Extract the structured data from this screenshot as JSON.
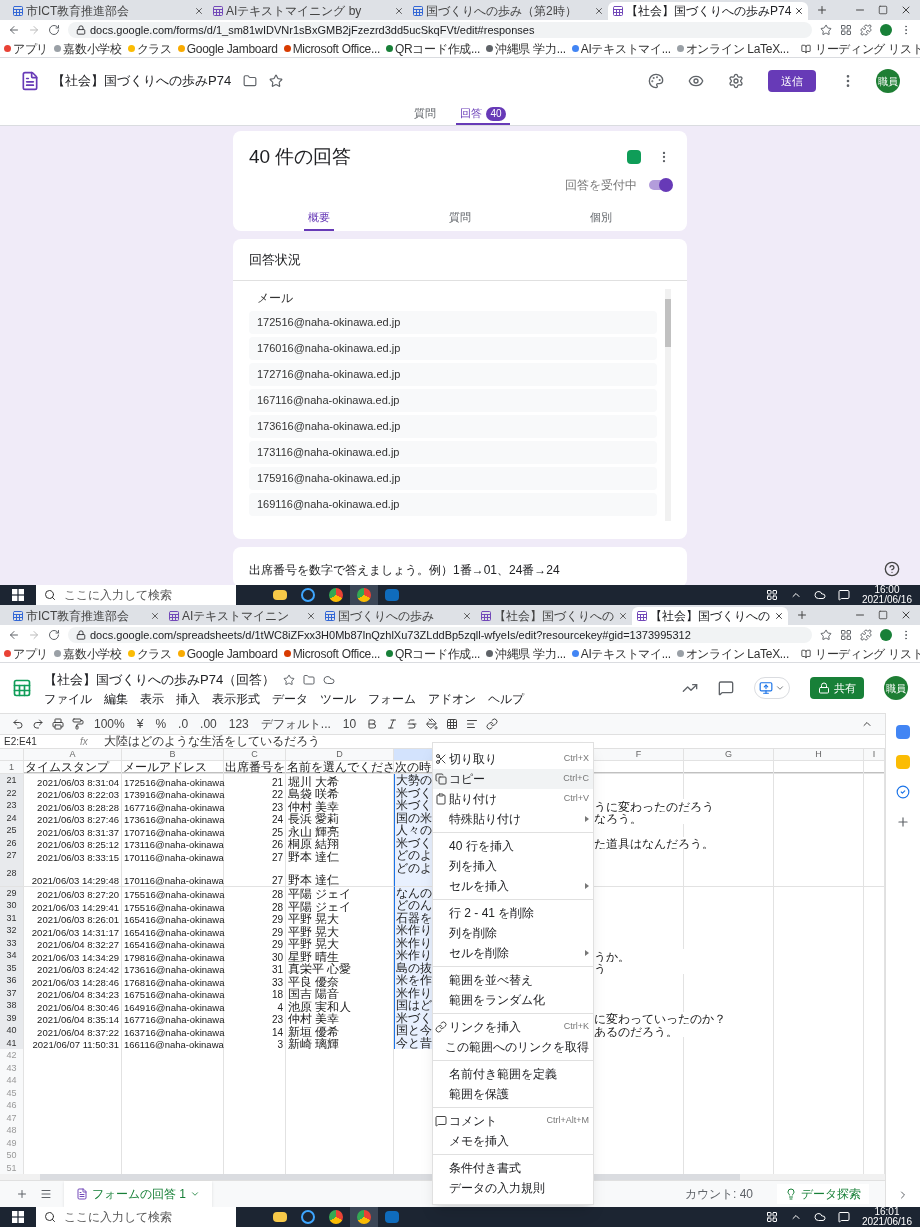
{
  "forms_window": {
    "browser": {
      "tabs": [
        {
          "label": "市ICT教育推進部会",
          "selected": false
        },
        {
          "label": "AIテキストマイニング by",
          "selected": false
        },
        {
          "label": "国づくりへの歩み（第2時）",
          "selected": false
        },
        {
          "label": "【社会】国づくりへの歩みP74",
          "selected": true
        }
      ],
      "url": "docs.google.com/forms/d/1_sm81wIDVNr1sBxGMB2jFzezrd3dd5ucSkqFVt/edit#responses",
      "bookmarks": [
        "アプリ",
        "嘉数小学校",
        "クラス",
        "Google Jamboard",
        "Microsoft Office...",
        "QRコード作成...",
        "沖縄県 学力...",
        "AIテキストマイ...",
        "オンライン LaTeX..."
      ],
      "reading_list": "リーディング リスト"
    },
    "title": "【社会】国づくりへの歩みP74",
    "send_button": "送信",
    "avatar": "職員",
    "top_tabs": [
      {
        "label": "質問",
        "selected": false
      },
      {
        "label": "回答",
        "selected": true,
        "badge": "40"
      }
    ],
    "summary_card": {
      "title": "40 件の回答",
      "accepting_label": "回答を受付中",
      "accepting": true,
      "tabs": [
        {
          "label": "概要",
          "selected": true
        },
        {
          "label": "質問",
          "selected": false
        },
        {
          "label": "個別",
          "selected": false
        }
      ]
    },
    "status_card": {
      "title": "回答状況",
      "question": "メール",
      "answers": [
        "172516@naha-okinawa.ed.jp",
        "176016@naha-okinawa.ed.jp",
        "172716@naha-okinawa.ed.jp",
        "167116@naha-okinawa.ed.jp",
        "173616@naha-okinawa.ed.jp",
        "173116@naha-okinawa.ed.jp",
        "175916@naha-okinawa.ed.jp",
        "169116@naha-okinawa.ed.jp"
      ]
    },
    "next_question": "出席番号を数字で答えましょう。例）1番→01、24番→24",
    "taskbar": {
      "search_placeholder": "ここに入力して検索",
      "time": "16:00",
      "date": "2021/06/16"
    }
  },
  "sheets_window": {
    "browser": {
      "tabs": [
        {
          "label": "市ICT教育推進部会",
          "selected": false
        },
        {
          "label": "AIテキストマイニン",
          "selected": false
        },
        {
          "label": "国づくりへの歩み",
          "selected": false
        },
        {
          "label": "【社会】国づくりへの",
          "selected": false
        },
        {
          "label": "【社会】国づくりへの",
          "selected": true
        }
      ],
      "url": "docs.google.com/spreadsheets/d/1tWC8iZFxx3H0Mb87lnQzhlXu73ZLddBp5zqll-wfyeIs/edit?resourcekey#gid=1373995312",
      "bookmarks": [
        "アプリ",
        "嘉数小学校",
        "クラス",
        "Google Jamboard",
        "Microsoft Office...",
        "QRコード作成...",
        "沖縄県 学力...",
        "AIテキストマイ...",
        "オンライン LaTeX..."
      ],
      "reading_list": "リーディング リスト"
    },
    "title": "【社会】国づくりへの歩みP74（回答）",
    "share_button": "共有",
    "avatar": "職員",
    "menus": [
      "ファイル",
      "編集",
      "表示",
      "挿入",
      "表示形式",
      "データ",
      "ツール",
      "フォーム",
      "アドオン",
      "ヘルプ"
    ],
    "toolbar": {
      "zoom": "100%",
      "currency": "¥",
      "percent": "%",
      "decrease_decimal": ".0",
      "increase_decimal": ".00",
      "number_format": "123",
      "font": "デフォルト...",
      "font_size": "10"
    },
    "name_box": "E2:E41",
    "fx_label": "fx",
    "formula": "大陸はどのような生活をしているだろう",
    "columns": [
      {
        "label": "A",
        "selected": false
      },
      {
        "label": "B",
        "selected": false
      },
      {
        "label": "C",
        "selected": false
      },
      {
        "label": "D",
        "selected": false
      },
      {
        "selected": true
      },
      {
        "label": "F",
        "selected": false
      },
      {
        "label": "G",
        "selected": false
      },
      {
        "label": "H",
        "selected": false
      },
      {
        "label": "I",
        "selected": false
      }
    ],
    "header_row": {
      "number": "1",
      "cells": [
        "タイムスタンプ",
        "メールアドレス",
        "出席番号を",
        "名前を選んでくださ",
        "次の時"
      ]
    },
    "rows": [
      {
        "number": "21",
        "selected": true,
        "tall": false,
        "timestamp": "2021/06/03 8:31:04",
        "email": "172516@naha-okinawa",
        "seat": "21",
        "name": "堀川 大希",
        "answer": "大勢の",
        "overflow": ""
      },
      {
        "number": "22",
        "selected": true,
        "tall": false,
        "timestamp": "2021/06/03 8:22:03",
        "email": "173916@naha-okinawa",
        "seat": "22",
        "name": "島袋 咲希",
        "answer": "米づく",
        "overflow": ""
      },
      {
        "number": "23",
        "selected": true,
        "tall": false,
        "timestamp": "2021/06/03 8:28:28",
        "email": "167716@naha-okinawa",
        "seat": "23",
        "name": "仲村 美幸",
        "answer": "米づく",
        "overflow": "うに変わったのだろう"
      },
      {
        "number": "24",
        "selected": true,
        "tall": false,
        "timestamp": "2021/06/03 8:27:46",
        "email": "173616@naha-okinawa",
        "seat": "24",
        "name": "長浜 愛莉",
        "answer": "国の米",
        "overflow": "なろう。"
      },
      {
        "number": "25",
        "selected": true,
        "tall": false,
        "timestamp": "2021/06/03 8:31:37",
        "email": "170716@naha-okinawa",
        "seat": "25",
        "name": "永山 輝亮",
        "answer": "人々の",
        "overflow": ""
      },
      {
        "number": "26",
        "selected": true,
        "tall": false,
        "timestamp": "2021/06/03 8:25:12",
        "email": "173116@naha-okinawa",
        "seat": "26",
        "name": "桐原 結翔",
        "answer": "米づく",
        "overflow": "た道具はなんだろう。"
      },
      {
        "number": "27",
        "selected": true,
        "tall": false,
        "timestamp": "2021/06/03 8:33:15",
        "email": "170116@naha-okinawa",
        "seat": "27",
        "name": "野本 達仁",
        "answer": "どのよ",
        "overflow": ""
      },
      {
        "number": "28",
        "selected": true,
        "tall": true,
        "timestamp": "2021/06/03 14:29:48",
        "email": "170116@naha-okinawa",
        "seat": "27",
        "name": "野本 達仁",
        "answer": "どのよ",
        "overflow": ""
      },
      {
        "number": "29",
        "selected": true,
        "tall": false,
        "timestamp": "2021/06/03 8:27:20",
        "email": "175516@naha-okinawa",
        "seat": "28",
        "name": "平陽 ジェイ",
        "answer": "なんの",
        "overflow": ""
      },
      {
        "number": "30",
        "selected": true,
        "tall": false,
        "timestamp": "2021/06/03 14:29:41",
        "email": "175516@naha-okinawa",
        "seat": "28",
        "name": "平陽 ジェイ",
        "answer": "どのん",
        "overflow": ""
      },
      {
        "number": "31",
        "selected": true,
        "tall": false,
        "timestamp": "2021/06/03 8:26:01",
        "email": "165416@naha-okinawa",
        "seat": "29",
        "name": "平野 晃大",
        "answer": "石器を",
        "overflow": ""
      },
      {
        "number": "32",
        "selected": true,
        "tall": false,
        "timestamp": "2021/06/03 14:31:17",
        "email": "165416@naha-okinawa",
        "seat": "29",
        "name": "平野 晃大",
        "answer": "米作り",
        "overflow": ""
      },
      {
        "number": "33",
        "selected": true,
        "tall": false,
        "timestamp": "2021/06/04 8:32:27",
        "email": "165416@naha-okinawa",
        "seat": "29",
        "name": "平野 晃大",
        "answer": "米作り",
        "overflow": ""
      },
      {
        "number": "34",
        "selected": true,
        "tall": false,
        "timestamp": "2021/06/03 14:34:29",
        "email": "179816@naha-okinawa",
        "seat": "30",
        "name": "星野 晴生",
        "answer": "米作り",
        "overflow": "うか。"
      },
      {
        "number": "35",
        "selected": true,
        "tall": false,
        "timestamp": "2021/06/03 8:24:42",
        "email": "173616@naha-okinawa",
        "seat": "31",
        "name": "真栄平 心愛",
        "answer": "島の抜",
        "overflow": "う"
      },
      {
        "number": "36",
        "selected": true,
        "tall": false,
        "timestamp": "2021/06/03 14:28:46",
        "email": "176816@naha-okinawa",
        "seat": "33",
        "name": "平良 優奈",
        "answer": "米を作",
        "overflow": ""
      },
      {
        "number": "37",
        "selected": true,
        "tall": false,
        "timestamp": "2021/06/04 8:34:23",
        "email": "167516@naha-okinawa",
        "seat": "18",
        "name": "国吉 陽音",
        "answer": "米作り",
        "overflow": ""
      },
      {
        "number": "38",
        "selected": true,
        "tall": false,
        "timestamp": "2021/06/04 8:30:46",
        "email": "164916@naha-okinawa",
        "seat": "4",
        "name": "池原 実和人",
        "answer": "国はど",
        "overflow": ""
      },
      {
        "number": "39",
        "selected": true,
        "tall": false,
        "timestamp": "2021/06/04 8:35:14",
        "email": "167716@naha-okinawa",
        "seat": "23",
        "name": "仲村 美幸",
        "answer": "米づく",
        "overflow": "に変わっていったのか？"
      },
      {
        "number": "40",
        "selected": true,
        "tall": false,
        "timestamp": "2021/06/04 8:37:22",
        "email": "163716@naha-okinawa",
        "seat": "14",
        "name": "新垣 優希",
        "answer": "国と今",
        "overflow": "あるのだろう。"
      },
      {
        "number": "41",
        "selected": true,
        "tall": false,
        "timestamp": "2021/06/07 11:50:31",
        "email": "166116@naha-okinawa",
        "seat": "3",
        "name": "新崎 璃輝",
        "answer": "今と昔",
        "overflow": ""
      },
      {
        "number": "42",
        "selected": false,
        "tall": false
      },
      {
        "number": "43",
        "selected": false,
        "tall": false
      },
      {
        "number": "44",
        "selected": false,
        "tall": false
      },
      {
        "number": "45",
        "selected": false,
        "tall": false
      },
      {
        "number": "46",
        "selected": false,
        "tall": false
      },
      {
        "number": "47",
        "selected": false,
        "tall": false
      },
      {
        "number": "48",
        "selected": false,
        "tall": false
      },
      {
        "number": "49",
        "selected": false,
        "tall": false
      },
      {
        "number": "50",
        "selected": false,
        "tall": false
      },
      {
        "number": "51",
        "selected": false,
        "tall": false
      }
    ],
    "context_menu": [
      [
        {
          "label": "切り取り",
          "shortcut": "Ctrl+X",
          "submenu": false,
          "selected": false
        },
        {
          "label": "コピー",
          "shortcut": "Ctrl+C",
          "submenu": false,
          "selected": true
        },
        {
          "label": "貼り付け",
          "shortcut": "Ctrl+V",
          "submenu": false,
          "selected": false
        },
        {
          "label": "特殊貼り付け",
          "submenu": true,
          "selected": false
        }
      ],
      [
        {
          "label": "40 行を挿入",
          "submenu": false,
          "selected": false
        },
        {
          "label": "列を挿入",
          "submenu": false,
          "selected": false
        },
        {
          "label": "セルを挿入",
          "submenu": true,
          "selected": false
        }
      ],
      [
        {
          "label": "行 2 - 41 を削除",
          "submenu": false,
          "selected": false
        },
        {
          "label": "列を削除",
          "submenu": false,
          "selected": false
        },
        {
          "label": "セルを削除",
          "submenu": true,
          "selected": false
        }
      ],
      [
        {
          "label": "範囲を並べ替え",
          "submenu": false,
          "selected": false
        },
        {
          "label": "範囲をランダム化",
          "submenu": false,
          "selected": false
        }
      ],
      [
        {
          "label": "リンクを挿入",
          "shortcut": "Ctrl+K",
          "submenu": false,
          "selected": false
        },
        {
          "label": "この範囲へのリンクを取得",
          "submenu": false,
          "selected": false
        }
      ],
      [
        {
          "label": "名前付き範囲を定義",
          "submenu": false,
          "selected": false
        },
        {
          "label": "範囲を保護",
          "submenu": false,
          "selected": false
        }
      ],
      [
        {
          "label": "コメント",
          "shortcut": "Ctrl+Alt+M",
          "submenu": false,
          "selected": false
        },
        {
          "label": "メモを挿入",
          "submenu": false,
          "selected": false
        }
      ],
      [
        {
          "label": "条件付き書式",
          "submenu": false,
          "selected": false
        },
        {
          "label": "データの入力規則",
          "submenu": false,
          "selected": false
        }
      ]
    ],
    "sheet_tab": "フォームの回答 1",
    "count": "カウント: 40",
    "explore_button": "データ探索",
    "taskbar": {
      "search_placeholder": "ここに入力して検索",
      "time": "16:01",
      "date": "2021/06/16"
    }
  }
}
